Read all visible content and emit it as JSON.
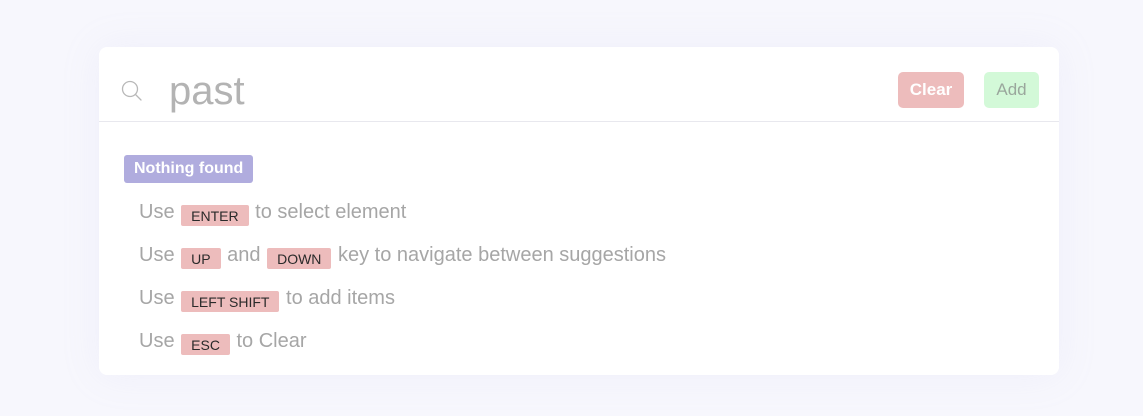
{
  "search": {
    "value": "past"
  },
  "buttons": {
    "clear_label": "Clear",
    "add_label": "Add"
  },
  "colors": {
    "clear_button": "#edbcbc",
    "add_button": "#d3f9d8",
    "badge": "#b0acde",
    "key_chip": "#edbcbc"
  },
  "results": {
    "status_badge": "Nothing found"
  },
  "hints": [
    {
      "prefix": "Use",
      "key1": "ENTER",
      "suffix": "to select element"
    },
    {
      "prefix": "Use",
      "key1": "UP",
      "middle": "and",
      "key2": "DOWN",
      "suffix": "key to navigate between suggestions"
    },
    {
      "prefix": "Use",
      "key1": "LEFT SHIFT",
      "suffix": "to add items"
    },
    {
      "prefix": "Use",
      "key1": "ESC",
      "suffix": "to Clear"
    }
  ],
  "icons": {
    "search": "search-icon"
  }
}
